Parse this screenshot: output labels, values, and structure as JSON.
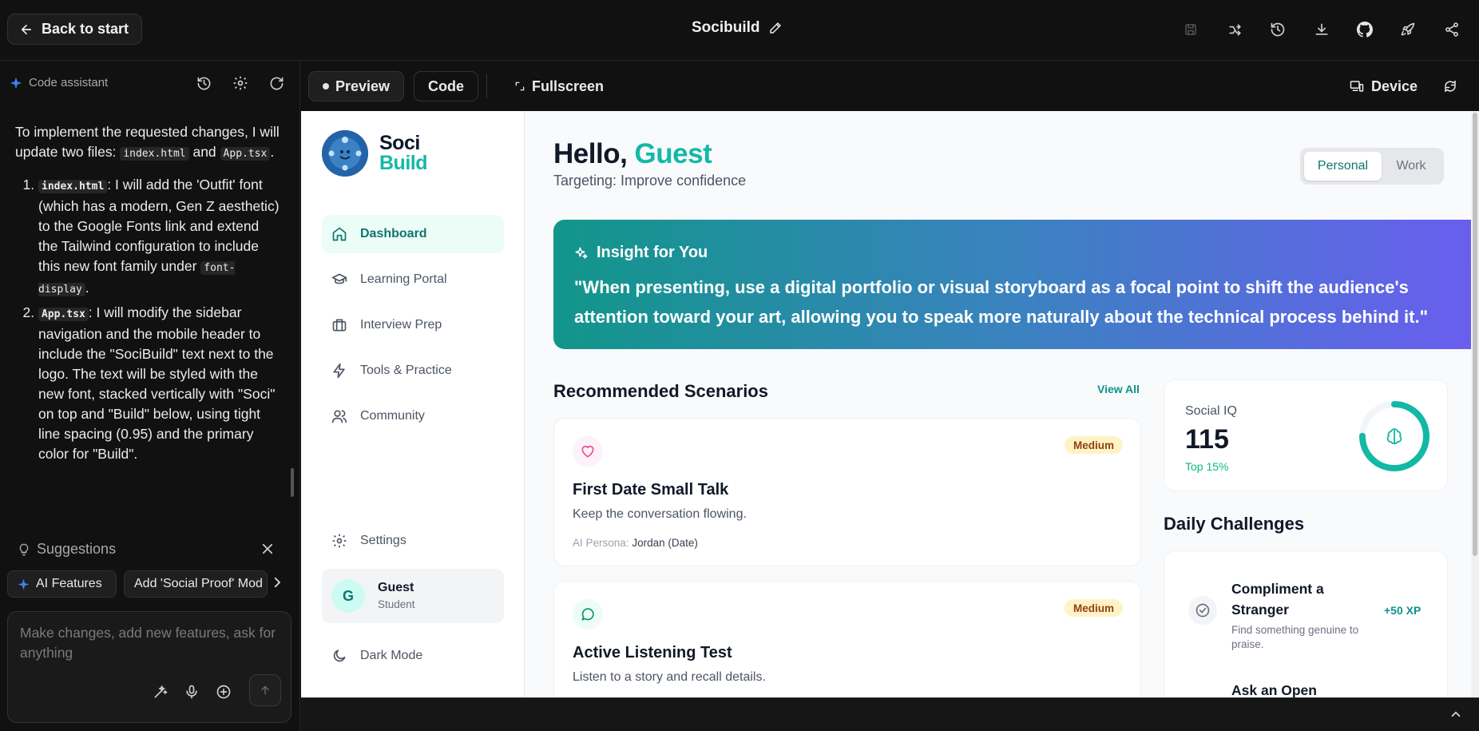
{
  "topbar": {
    "back_label": "Back to start",
    "app_title": "Socibuild"
  },
  "chat": {
    "header": "Code assistant",
    "intro_1": "To implement the requested changes, I will update two files: ",
    "file_1": "index.html",
    "intro_and": " and ",
    "file_2": "App.tsx",
    "intro_end": ".",
    "item_1_file": "index.html",
    "item_1_a": ": I will add the 'Outfit' font (which has a modern, Gen Z aesthetic) to the Google Fonts link and extend the Tailwind configuration to include this new font family under ",
    "item_1_code": "font-display",
    "item_1_end": ".",
    "item_2_file": "App.tsx",
    "item_2_text": ": I will modify the sidebar navigation and the mobile header to include the \"SociBuild\" text next to the logo. The text will be styled with the new font, stacked vertically with \"Soci\" on top and \"Build\" below, using tight line spacing (0.95) and the primary color for \"Build\".",
    "suggestions_label": "Suggestions",
    "chip_1": "AI Features",
    "chip_2": "Add 'Social Proof' Mod",
    "input_placeholder": "Make changes, add new features, ask for anything"
  },
  "preview_toolbar": {
    "preview": "Preview",
    "code": "Code",
    "fullscreen": "Fullscreen",
    "device": "Device"
  },
  "app": {
    "logo_top": "Soci",
    "logo_bottom": "Build",
    "nav": {
      "dashboard": "Dashboard",
      "learning": "Learning Portal",
      "interview": "Interview Prep",
      "tools": "Tools & Practice",
      "community": "Community",
      "settings": "Settings",
      "dark_mode": "Dark Mode"
    },
    "user": {
      "initial": "G",
      "name": "Guest",
      "role": "Student"
    },
    "greeting": "Hello,",
    "greeting_name": "Guest",
    "targeting": "Targeting: Improve confidence",
    "toggle": {
      "personal": "Personal",
      "work": "Work"
    },
    "insight": {
      "title": "Insight for You",
      "quote": "\"When presenting, use a digital portfolio or visual storyboard as a focal point to shift the audience's attention toward your art, allowing you to speak more naturally about the technical process behind it.\""
    },
    "recommended_title": "Recommended Scenarios",
    "view_all": "View All",
    "scenarios": [
      {
        "title": "First Date Small Talk",
        "desc": "Keep the conversation flowing.",
        "badge": "Medium",
        "persona_label": "AI Persona:",
        "persona": "Jordan (Date)"
      },
      {
        "title": "Active Listening Test",
        "desc": "Listen to a story and recall details.",
        "badge": "Medium"
      }
    ],
    "social_iq": {
      "label": "Social IQ",
      "value": "115",
      "rank": "Top 15%",
      "progress": 0.75
    },
    "daily_title": "Daily Challenges",
    "challenges": [
      {
        "title": "Compliment a Stranger",
        "desc": "Find something genuine to praise.",
        "xp": "+50 XP"
      },
      {
        "title": "Ask an Open"
      }
    ]
  },
  "colors": {
    "accent": "#14b8a6",
    "insight_start": "#11968a",
    "insight_end": "#6a5df0",
    "badge_bg": "#fef3c7"
  }
}
